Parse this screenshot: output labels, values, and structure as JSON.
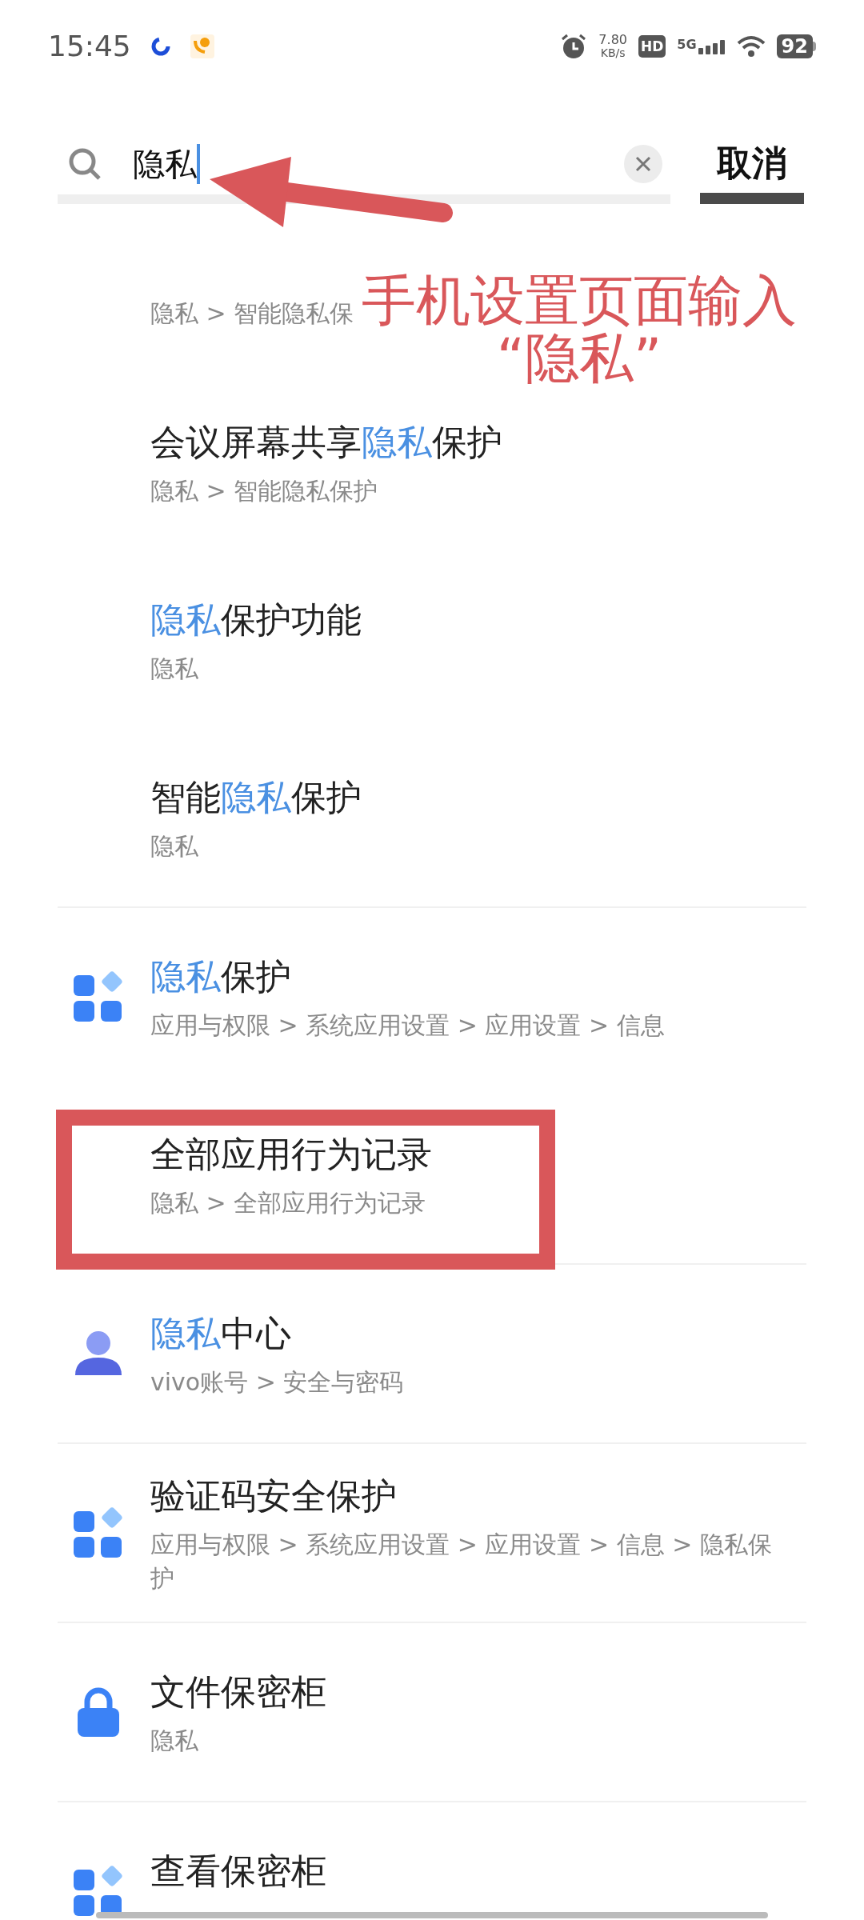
{
  "status_bar": {
    "time": "15:45",
    "net_speed": "7.80",
    "net_unit": "KB/s",
    "hd": "HD",
    "network": "5G",
    "battery": "92"
  },
  "search": {
    "value": "隐私",
    "cancel": "取消"
  },
  "sections": [
    [
      {
        "kind": "plain",
        "path": "隐私 > 智能隐私保"
      },
      {
        "kind": "plain",
        "title": [
          {
            "text": "会议屏幕共享",
            "hl": false
          },
          {
            "text": "隐私",
            "hl": true
          },
          {
            "text": "保护",
            "hl": false
          }
        ],
        "path": "隐私 > 智能隐私保护"
      },
      {
        "kind": "plain",
        "title": [
          {
            "text": "隐私",
            "hl": true
          },
          {
            "text": "保护功能",
            "hl": false
          }
        ],
        "path": "隐私"
      },
      {
        "kind": "plain",
        "title": [
          {
            "text": "智能",
            "hl": false
          },
          {
            "text": "隐私",
            "hl": true
          },
          {
            "text": "保护",
            "hl": false
          }
        ],
        "path": "隐私"
      }
    ],
    [
      {
        "kind": "apps",
        "title": [
          {
            "text": "隐私",
            "hl": true
          },
          {
            "text": "保护",
            "hl": false
          }
        ],
        "path": "应用与权限 > 系统应用设置 > 应用设置 > 信息"
      },
      {
        "kind": "plain",
        "title": [
          {
            "text": "全部应用行为记录",
            "hl": false
          }
        ],
        "path": "隐私 > 全部应用行为记录",
        "marked": true
      }
    ],
    [
      {
        "kind": "person",
        "title": [
          {
            "text": "隐私",
            "hl": true
          },
          {
            "text": "中心",
            "hl": false
          }
        ],
        "path": "vivo账号 > 安全与密码"
      }
    ],
    [
      {
        "kind": "apps",
        "title": [
          {
            "text": "验证码安全保护",
            "hl": false
          }
        ],
        "path": "应用与权限 > 系统应用设置 > 应用设置 > 信息 > 隐私保护"
      }
    ],
    [
      {
        "kind": "lock",
        "title": [
          {
            "text": "文件保密柜",
            "hl": false
          }
        ],
        "path": "隐私"
      }
    ],
    [
      {
        "kind": "apps",
        "title": [
          {
            "text": "查看保密柜",
            "hl": false
          }
        ]
      }
    ]
  ],
  "annotation": {
    "lines": [
      "手机设置页面输入",
      "“隐私”"
    ]
  }
}
